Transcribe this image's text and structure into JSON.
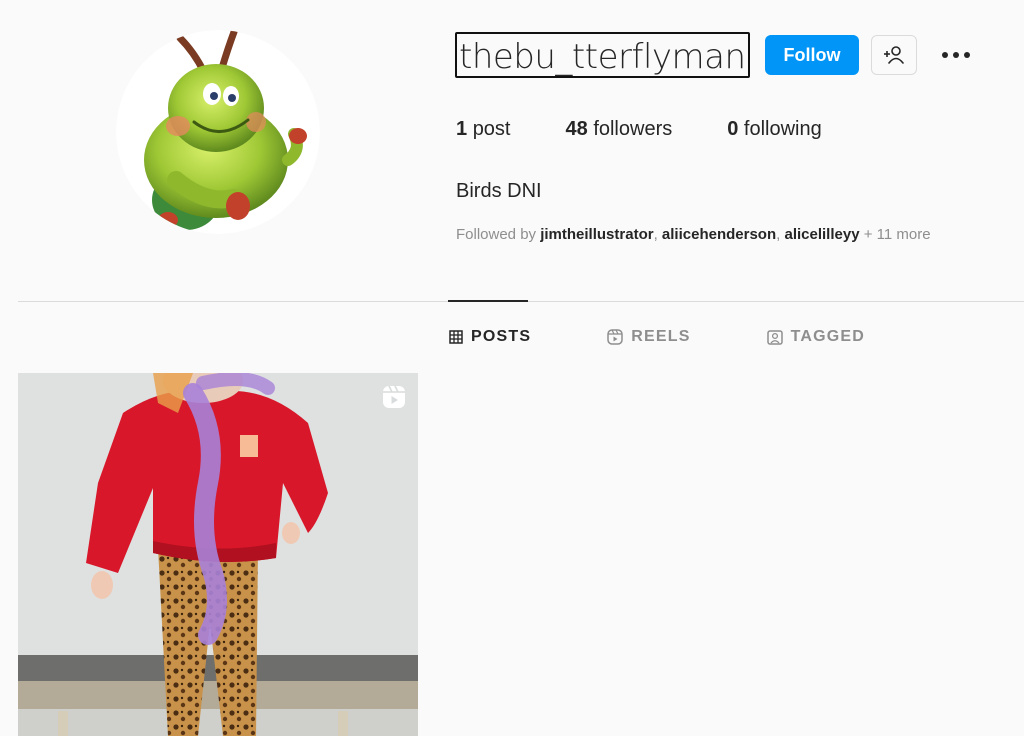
{
  "profile": {
    "username": "thebu_tterflyman",
    "follow_label": "Follow",
    "stats": {
      "posts_count": "1",
      "posts_label": "post",
      "followers_count": "48",
      "followers_label": "followers",
      "following_count": "0",
      "following_label": "following"
    },
    "bio": "Birds DNI",
    "followed_by": {
      "prefix": "Followed by",
      "users": [
        "jimtheillustrator",
        "aliicehenderson",
        "alicelilleyy"
      ],
      "more": "+ 11 more"
    }
  },
  "tabs": [
    {
      "label": "POSTS",
      "icon": "grid-icon",
      "active": true
    },
    {
      "label": "REELS",
      "icon": "reels-icon",
      "active": false
    },
    {
      "label": "TAGGED",
      "icon": "tagged-icon",
      "active": false
    }
  ],
  "posts": [
    {
      "type": "reel",
      "icon": "reel-icon"
    }
  ],
  "colors": {
    "accent": "#0095f6",
    "text": "#262626",
    "muted": "#8e8e8e",
    "background": "#fafafa",
    "border": "#dbdbdb"
  }
}
